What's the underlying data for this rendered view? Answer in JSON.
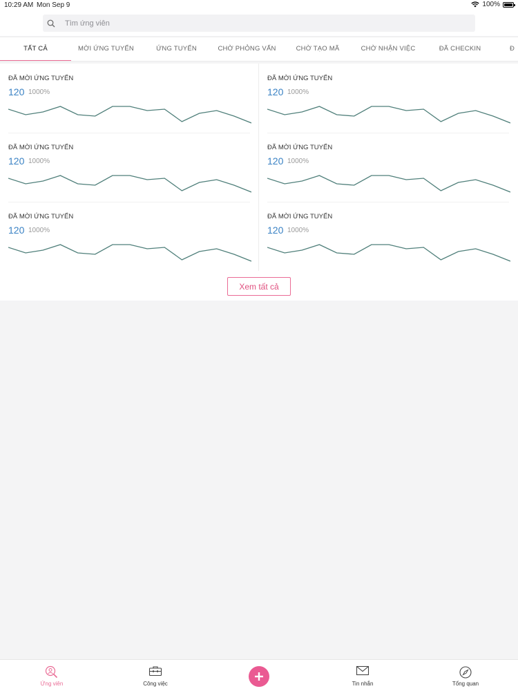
{
  "status_bar": {
    "time": "10:29 AM",
    "date": "Mon Sep 9",
    "battery": "100%",
    "battery_level": 1.0
  },
  "search": {
    "placeholder": "Tìm ứng viên",
    "value": "",
    "icon": "search-icon"
  },
  "tabs": [
    {
      "label": "TẤT CẢ",
      "active": true
    },
    {
      "label": "MỜI ỨNG TUYỂN"
    },
    {
      "label": "ỨNG TUYỂN"
    },
    {
      "label": "CHỜ PHỎNG VẤN"
    },
    {
      "label": "CHỜ TẠO MÃ"
    },
    {
      "label": "CHỜ NHẬN VIỆC"
    },
    {
      "label": "ĐÃ CHECKIN"
    },
    {
      "label": "Đ"
    }
  ],
  "cards": [
    {
      "label": "ĐÃ MỜI ỨNG TUYỂN",
      "value": "120",
      "percent": "1000%"
    },
    {
      "label": "ĐÃ MỜI ỨNG TUYỂN",
      "value": "120",
      "percent": "1000%"
    },
    {
      "label": "ĐÃ MỜI ỨNG TUYỂN",
      "value": "120",
      "percent": "1000%"
    },
    {
      "label": "ĐÃ MỜI ỨNG TUYỂN",
      "value": "120",
      "percent": "1000%"
    },
    {
      "label": "ĐÃ MỜI ỨNG TUYỂN",
      "value": "120",
      "percent": "1000%"
    },
    {
      "label": "ĐÃ MỜI ỨNG TUYỂN",
      "value": "120",
      "percent": "1000%"
    }
  ],
  "sparkline": {
    "values": [
      6,
      4,
      5,
      7,
      4,
      3.5,
      7,
      7,
      5.5,
      6,
      1.5,
      4.5,
      5.5,
      3.5,
      1
    ],
    "color": "#4f7f7a"
  },
  "see_all_label": "Xem tất cả",
  "bottom_nav": {
    "items": [
      {
        "label": "Ứng viên",
        "icon": "candidate-search-icon",
        "active": true
      },
      {
        "label": "Công việc",
        "icon": "briefcase-icon"
      },
      {
        "label": "Tin nhắn",
        "icon": "mail-icon"
      },
      {
        "label": "Tổng quan",
        "icon": "compass-icon"
      }
    ],
    "center_button_icon": "plus-icon"
  },
  "colors": {
    "accent": "#ea6b95",
    "value_blue": "#3a82c4",
    "line": "#4f7f7a"
  }
}
